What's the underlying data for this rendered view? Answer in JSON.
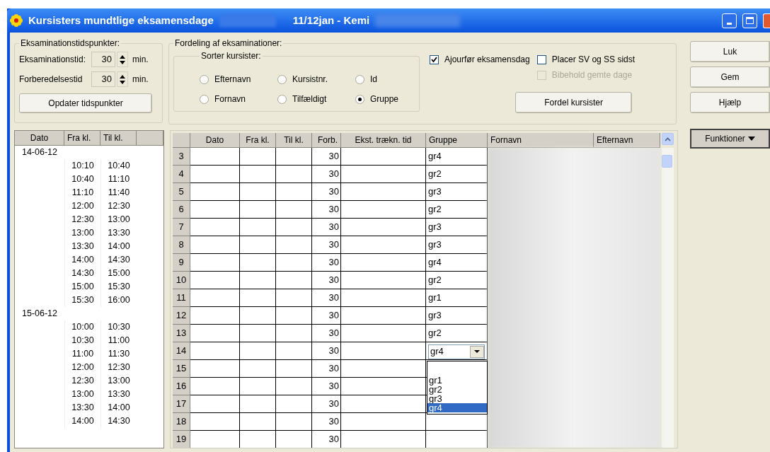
{
  "window": {
    "title": "Kursisters mundtlige eksamensdage",
    "title_suffix": "11/12jan - Kemi"
  },
  "exam_times": {
    "label": "Eksaminationstidspunkter:",
    "fields": [
      {
        "label": "Eksaminationstid:",
        "value": "30",
        "unit": "min."
      },
      {
        "label": "Forberedelsestid",
        "value": "30",
        "unit": "min."
      }
    ],
    "button": "Opdater tidspunkter"
  },
  "distribution": {
    "label": "Fordeling af eksaminationer:",
    "sort_label": "Sorter kursister:",
    "sort_options": [
      {
        "label": "Efternavn",
        "selected": false
      },
      {
        "label": "Kursistnr.",
        "selected": false
      },
      {
        "label": "Id",
        "selected": false
      },
      {
        "label": "Fornavn",
        "selected": false
      },
      {
        "label": "Tilfældigt",
        "selected": false
      },
      {
        "label": "Gruppe",
        "selected": true
      }
    ],
    "checkboxes": [
      {
        "label": "Ajourfør eksamensdag",
        "checked": true,
        "disabled": false
      },
      {
        "label": "Placer SV og SS sidst",
        "checked": false,
        "disabled": false
      },
      {
        "label": "Bibehold gemte dage",
        "checked": false,
        "disabled": true
      }
    ],
    "button": "Fordel kursister"
  },
  "side_buttons": [
    "Luk",
    "Gem",
    "Hjælp"
  ],
  "menu_button": "Funktioner",
  "schedule": {
    "columns": [
      "Dato",
      "Fra kl.",
      "Til kl."
    ],
    "rows": [
      {
        "date": "14-06-12"
      },
      {
        "from": "10:10",
        "to": "10:40"
      },
      {
        "from": "10:40",
        "to": "11:10"
      },
      {
        "from": "11:10",
        "to": "11:40"
      },
      {
        "from": "12:00",
        "to": "12:30"
      },
      {
        "from": "12:30",
        "to": "13:00"
      },
      {
        "from": "13:00",
        "to": "13:30"
      },
      {
        "from": "13:30",
        "to": "14:00"
      },
      {
        "from": "14:00",
        "to": "14:30"
      },
      {
        "from": "14:30",
        "to": "15:00"
      },
      {
        "from": "15:00",
        "to": "15:30"
      },
      {
        "from": "15:30",
        "to": "16:00"
      },
      {
        "date": "15-06-12"
      },
      {
        "from": "10:00",
        "to": "10:30"
      },
      {
        "from": "10:30",
        "to": "11:00"
      },
      {
        "from": "11:00",
        "to": "11:30"
      },
      {
        "from": "12:00",
        "to": "12:30"
      },
      {
        "from": "12:30",
        "to": "13:00"
      },
      {
        "from": "13:00",
        "to": "13:30"
      },
      {
        "from": "13:30",
        "to": "14:00"
      },
      {
        "from": "14:00",
        "to": "14:30"
      }
    ]
  },
  "grid": {
    "columns": [
      "Dato",
      "Fra kl.",
      "Til kl.",
      "Forb.",
      "Ekst. trækn. tid",
      "Gruppe",
      "Fornavn",
      "Efternavn"
    ],
    "rows": [
      {
        "number": "3",
        "forb": "30",
        "gruppe": "gr4"
      },
      {
        "number": "4",
        "forb": "30",
        "gruppe": "gr2"
      },
      {
        "number": "5",
        "forb": "30",
        "gruppe": "gr3"
      },
      {
        "number": "6",
        "forb": "30",
        "gruppe": "gr2"
      },
      {
        "number": "7",
        "forb": "30",
        "gruppe": "gr3"
      },
      {
        "number": "8",
        "forb": "30",
        "gruppe": "gr3"
      },
      {
        "number": "9",
        "forb": "30",
        "gruppe": "gr4"
      },
      {
        "number": "10",
        "forb": "30",
        "gruppe": "gr2"
      },
      {
        "number": "11",
        "forb": "30",
        "gruppe": "gr1"
      },
      {
        "number": "12",
        "forb": "30",
        "gruppe": "gr3"
      },
      {
        "number": "13",
        "forb": "30",
        "gruppe": "gr2"
      },
      {
        "number": "14",
        "forb": "30",
        "gruppe": "gr4",
        "kind": "combo"
      },
      {
        "number": "15",
        "forb": "30"
      },
      {
        "number": "16",
        "forb": "30"
      },
      {
        "number": "17",
        "forb": "30"
      },
      {
        "number": "18",
        "forb": "30"
      },
      {
        "number": "19",
        "forb": "30"
      }
    ],
    "dropdown": [
      {
        "label": "gr1",
        "selected": false
      },
      {
        "label": "gr2",
        "selected": false
      },
      {
        "label": "gr3",
        "selected": false
      },
      {
        "label": "gr4",
        "selected": true
      }
    ]
  }
}
